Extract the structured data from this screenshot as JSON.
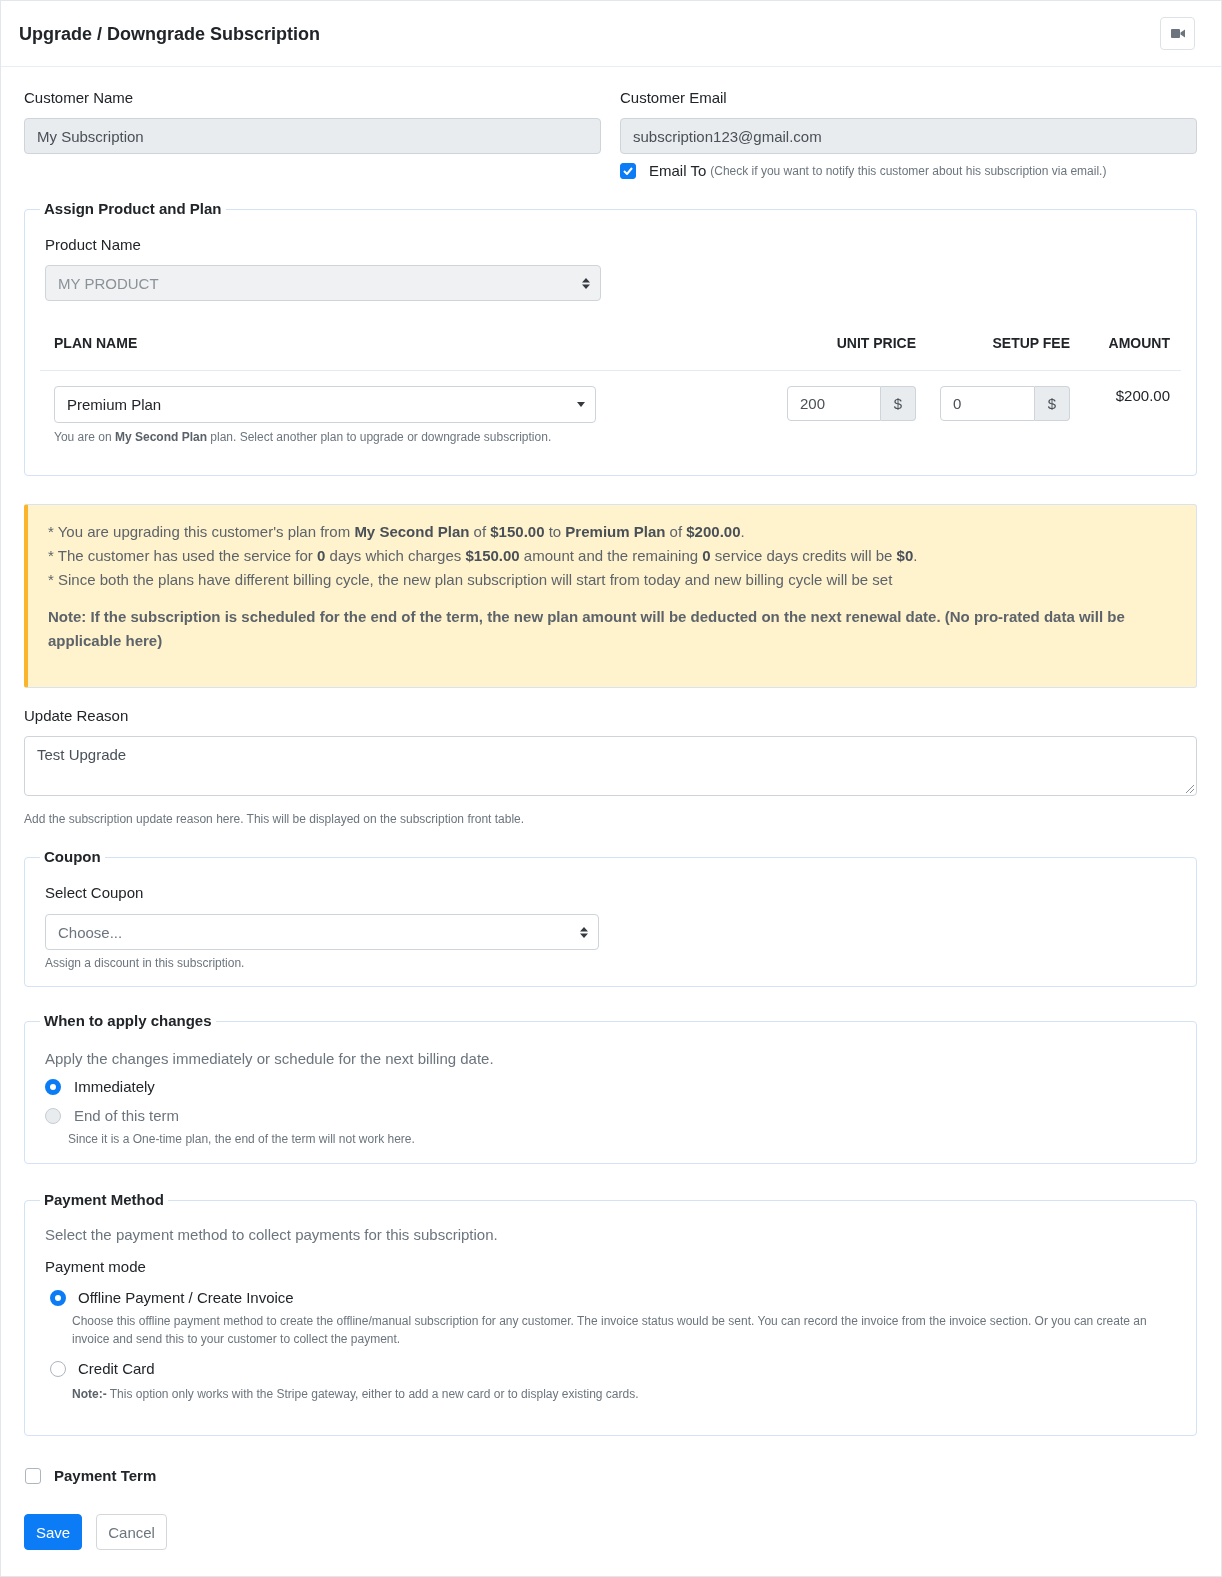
{
  "header": {
    "title": "Upgrade / Downgrade Subscription"
  },
  "customer": {
    "name": {
      "label": "Customer Name",
      "value": "My Subscription",
      "readonly": true
    },
    "email": {
      "label": "Customer Email",
      "value": "subscription123@gmail.com",
      "readonly": true
    },
    "email_to": {
      "label": "Email To",
      "hint": "(Check if you want to notify this customer about his subscription via email.)",
      "checked": true
    }
  },
  "product_plan": {
    "legend": "Assign Product and Plan",
    "product": {
      "label": "Product Name",
      "value": "MY PRODUCT",
      "disabled": true
    },
    "columns": [
      "PLAN NAME",
      "UNIT PRICE",
      "SETUP FEE",
      "AMOUNT"
    ],
    "row": {
      "plan": "Premium Plan",
      "unit_price": "200",
      "unit_price_currency": "$",
      "setup_fee": "0",
      "setup_fee_currency": "$",
      "amount": "$200.00",
      "help": "You are on **My Second Plan** plan. Select another plan to upgrade or downgrade subscription."
    }
  },
  "notice": {
    "lines": [
      "* You are upgrading this customer's plan from **My Second Plan** of **$150.00** to **Premium Plan** of **$200.00**.",
      "* The customer has used the service for **0** days which charges **$150.00** amount and the remaining **0** service days credits will be **$0**.",
      "* Since both the plans have different billing cycle, the new plan subscription will start from today and new billing cycle will be set"
    ],
    "note": "Note: If the subscription is scheduled for the end of the term, the new plan amount will be deducted on the next renewal date. (No pro-rated data will be applicable here)"
  },
  "update_reason": {
    "label": "Update Reason",
    "value": "Test Upgrade",
    "help": "Add the subscription update reason here. This will be displayed on the subscription front table."
  },
  "coupon": {
    "legend": "Coupon",
    "label": "Select Coupon",
    "placeholder": "Choose...",
    "help": "Assign a discount in this subscription."
  },
  "apply_changes": {
    "legend": "When to apply changes",
    "description": "Apply the changes immediately or schedule for the next billing date.",
    "options": [
      {
        "label": "Immediately",
        "selected": true,
        "disabled": false
      },
      {
        "label": "End of this term",
        "selected": false,
        "disabled": true,
        "note": "Since it is a One-time plan, the end of the term will not work here."
      }
    ]
  },
  "payment": {
    "legend": "Payment Method",
    "description": "Select the payment method to collect payments for this subscription.",
    "mode_label": "Payment mode",
    "options": [
      {
        "label": "Offline Payment / Create Invoice",
        "selected": true,
        "note": "Choose this offline payment method to create the offline/manual subscription for any customer. The invoice status would be sent. You can record the invoice from the invoice section. Or you can create an invoice and send this to your customer to collect the payment."
      },
      {
        "label": "Credit Card",
        "selected": false,
        "note": "**Note:-** This option only works with the Stripe gateway, either to add a new card or to display existing cards."
      }
    ]
  },
  "payment_term": {
    "label": "Payment Term",
    "checked": false
  },
  "buttons": [
    {
      "label": "Save",
      "kind": "primary"
    },
    {
      "label": "Cancel",
      "kind": "secondary"
    }
  ]
}
